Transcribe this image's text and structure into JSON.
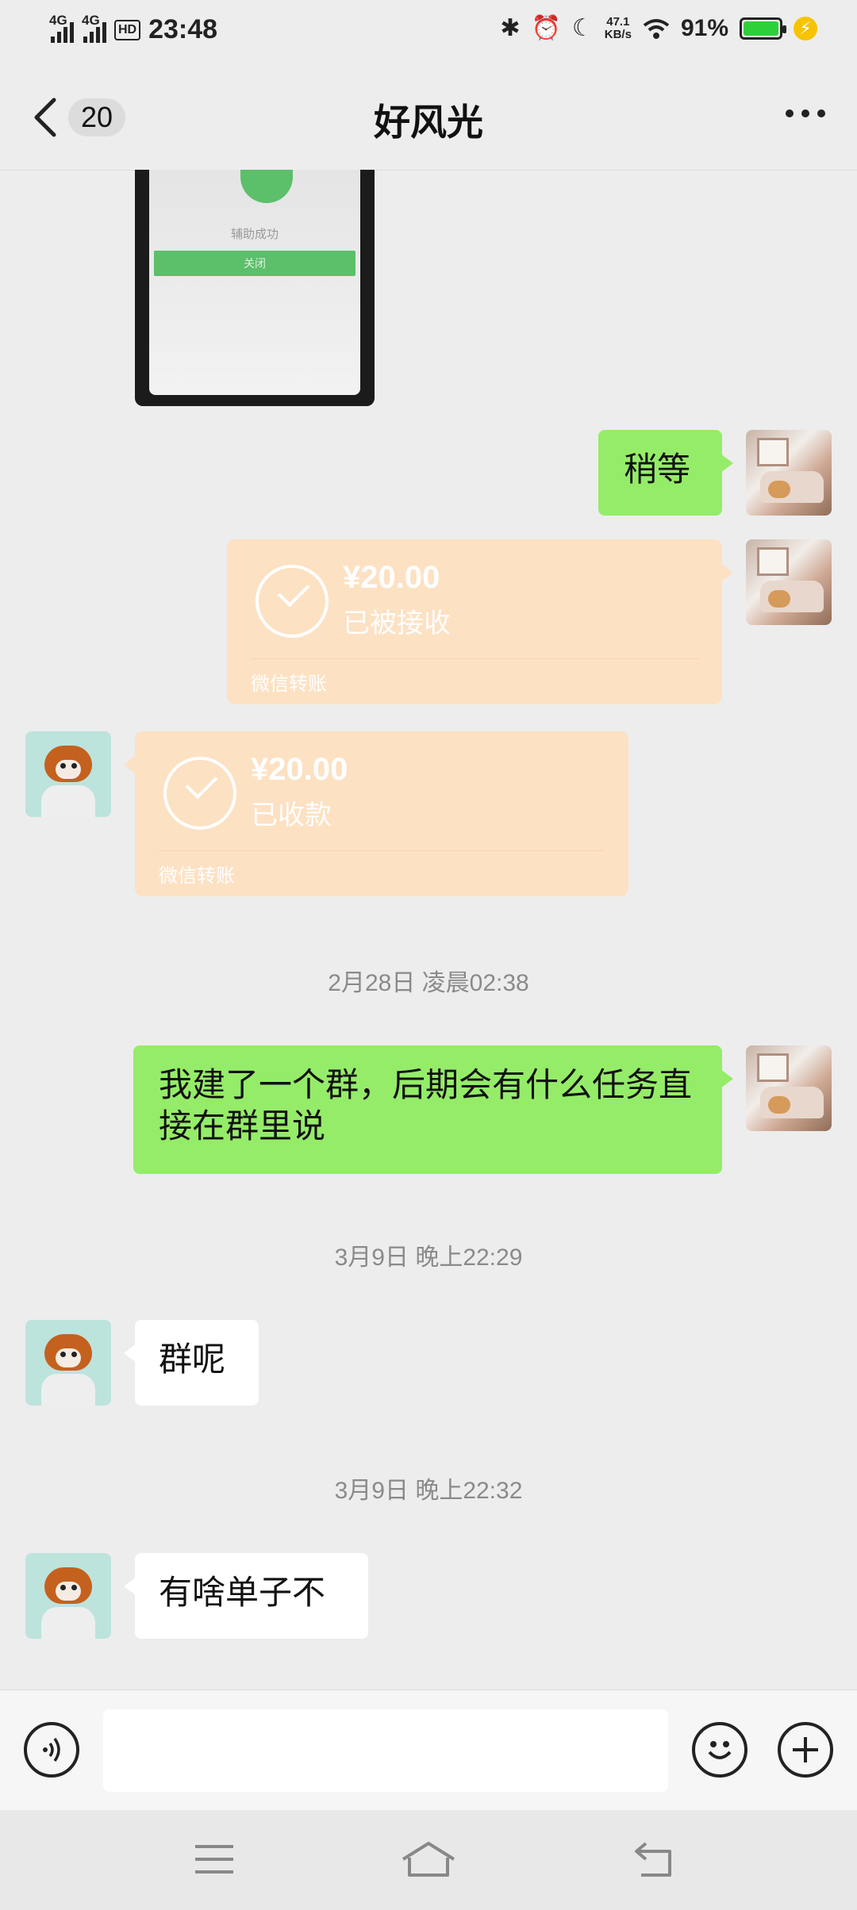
{
  "status_bar": {
    "net1": "4G",
    "net2": "4G",
    "hd": "HD",
    "time": "23:48",
    "speed_value": "47.1",
    "speed_unit": "KB/s",
    "battery": "91%"
  },
  "header": {
    "unread_count": "20",
    "title": "好风光"
  },
  "photo": {
    "caption": "辅助成功",
    "button": "关闭"
  },
  "messages": {
    "m1": "稍等",
    "transfer1": {
      "amount": "¥20.00",
      "status": "已被接收",
      "label": "微信转账"
    },
    "transfer2": {
      "amount": "¥20.00",
      "status": "已收款",
      "label": "微信转账"
    },
    "time1": "2月28日 凌晨02:38",
    "m2": "我建了一个群，后期会有什么任务直接在群里说",
    "time2": "3月9日 晚上22:29",
    "m3": "群呢",
    "time3": "3月9日 晚上22:32",
    "m4": "有啥单子不"
  },
  "input": {
    "value": ""
  },
  "colors": {
    "sent_bubble": "#95ec69",
    "received_bubble": "#ffffff",
    "transfer_card": "#fde1c3",
    "background": "#ededed"
  },
  "icons": {
    "back": "chevron-left-icon",
    "more": "more-dots-icon",
    "voice": "voice-icon",
    "emoji": "emoji-icon",
    "plus": "plus-icon",
    "menu": "menu-icon",
    "home": "home-icon",
    "return": "back-arrow-icon"
  }
}
